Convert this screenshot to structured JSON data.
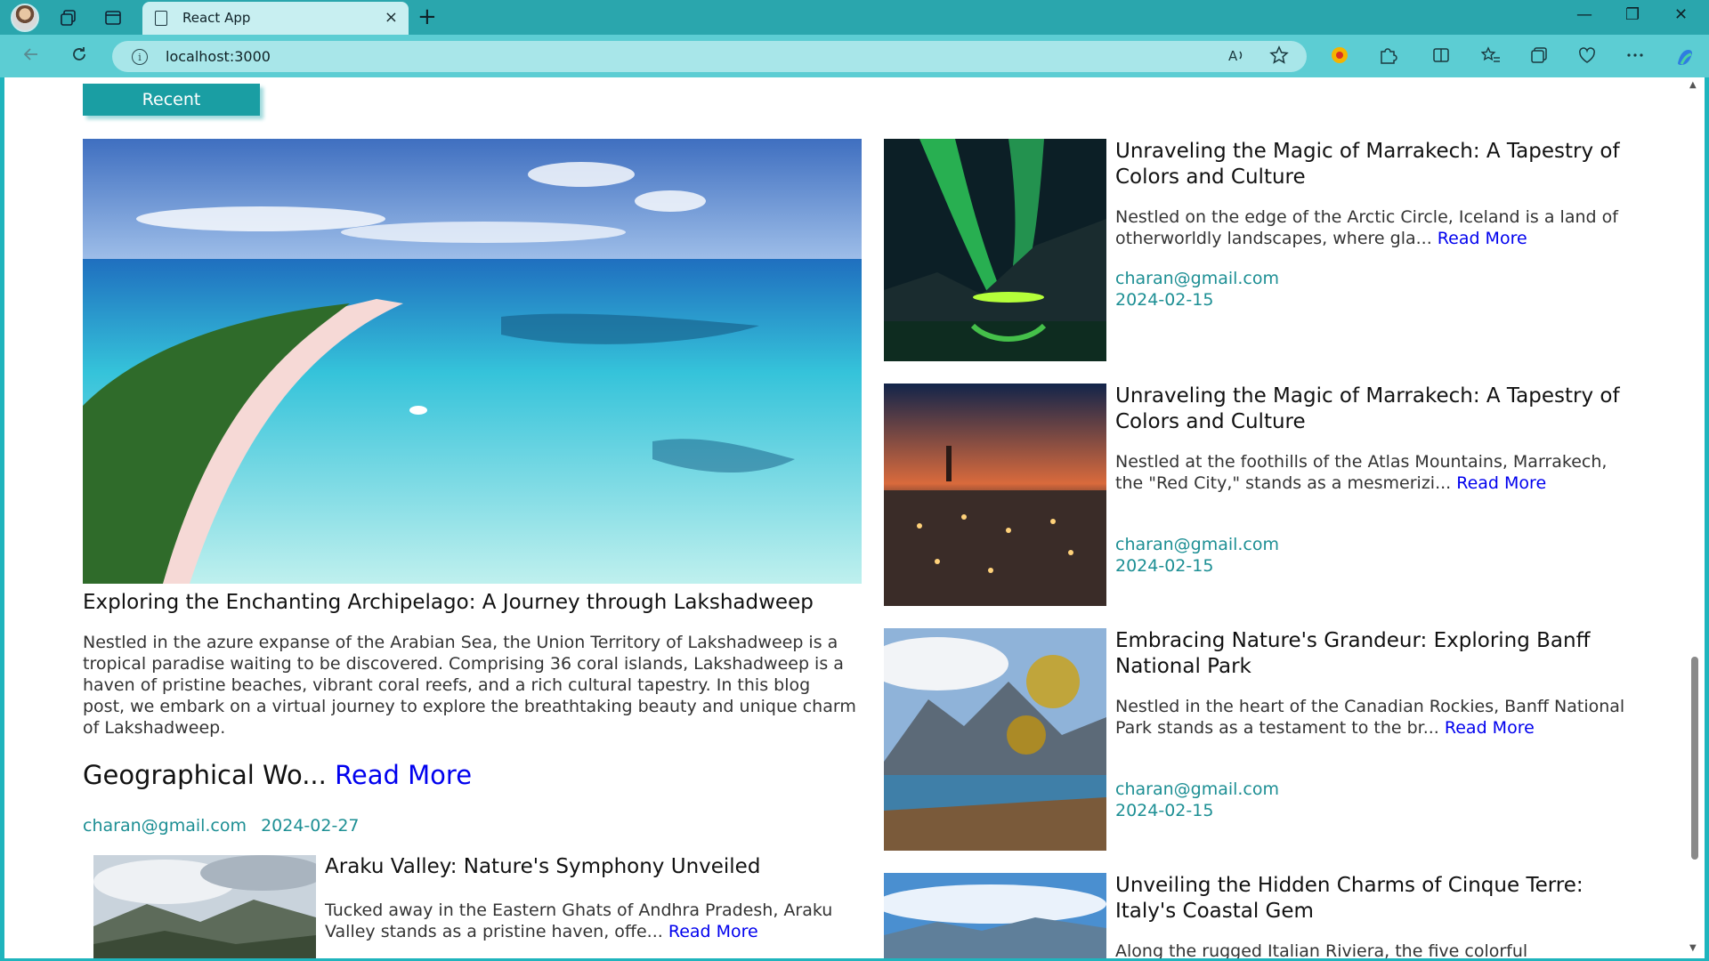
{
  "browser": {
    "tab_title": "React App",
    "tab_close": "×",
    "new_tab": "+",
    "url": "localhost:3000",
    "window_minimize": "—",
    "window_restore": "❐",
    "window_close": "✕"
  },
  "page": {
    "recent_label": "Recent",
    "hero": {
      "title": "Exploring the Enchanting Archipelago: A Journey through Lakshadweep",
      "text": "Nestled in the azure expanse of the Arabian Sea, the Union Territory of Lakshadweep is a tropical paradise waiting to be discovered. Comprising 36 coral islands, Lakshadweep is a haven of pristine beaches, vibrant coral reefs, and a rich cultural tapestry. In this blog post, we embark on a virtual journey to explore the breathtaking beauty and unique charm of Lakshadweep.",
      "truncated": "Geographical Wo... ",
      "read_more": "Read More",
      "author": "charan@gmail.com",
      "date": "2024-02-27"
    },
    "small_card": {
      "title": "Araku Valley: Nature's Symphony Unveiled",
      "text": "Tucked away in the Eastern Ghats of Andhra Pradesh, Araku Valley stands as a pristine haven, offe... ",
      "read_more": "Read More"
    },
    "cards": [
      {
        "title": "Unraveling the Magic of Marrakech: A Tapestry of Colors and Culture",
        "text": "Nestled on the edge of the Arctic Circle, Iceland is a land of otherworldly landscapes, where gla... ",
        "read_more": "Read More",
        "author": "charan@gmail.com",
        "date": "2024-02-15"
      },
      {
        "title": "Unraveling the Magic of Marrakech: A Tapestry of Colors and Culture",
        "text": "Nestled at the foothills of the Atlas Mountains, Marrakech, the \"Red City,\" stands as a mesmerizi... ",
        "read_more": "Read More",
        "author": "charan@gmail.com",
        "date": "2024-02-15"
      },
      {
        "title": "Embracing Nature's Grandeur: Exploring Banff National Park",
        "text": "Nestled in the heart of the Canadian Rockies, Banff National Park stands as a testament to the br... ",
        "read_more": "Read More",
        "author": "charan@gmail.com",
        "date": "2024-02-15"
      },
      {
        "title": "Unveiling the Hidden Charms of Cinque Terre: Italy's Coastal Gem",
        "text": "Along the rugged Italian Riviera, the five colorful"
      }
    ]
  },
  "colors": {
    "accent": "#1a9ea3",
    "meta_text": "#1d8f94",
    "link": "#0000ee",
    "chrome": "#2aa6ad"
  }
}
